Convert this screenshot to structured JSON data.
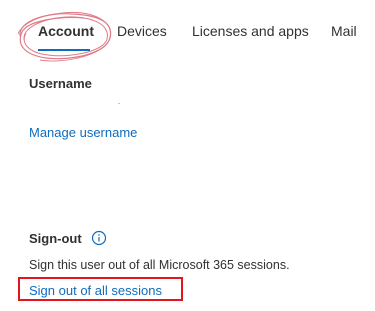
{
  "tabs": [
    {
      "label": "Account",
      "active": true
    },
    {
      "label": "Devices",
      "active": false
    },
    {
      "label": "Licenses and apps",
      "active": false
    },
    {
      "label": "Mail",
      "active": false
    }
  ],
  "username": {
    "heading": "Username",
    "manage_link": "Manage username"
  },
  "signout": {
    "heading": "Sign-out",
    "info_icon": "info-icon",
    "description": "Sign this user out of all Microsoft 365 sessions.",
    "action_link": "Sign out of all sessions"
  },
  "colors": {
    "accent": "#0f6cbd",
    "text": "#323130",
    "annotation_red": "#e3141c",
    "scribble_red": "#e07a86"
  }
}
